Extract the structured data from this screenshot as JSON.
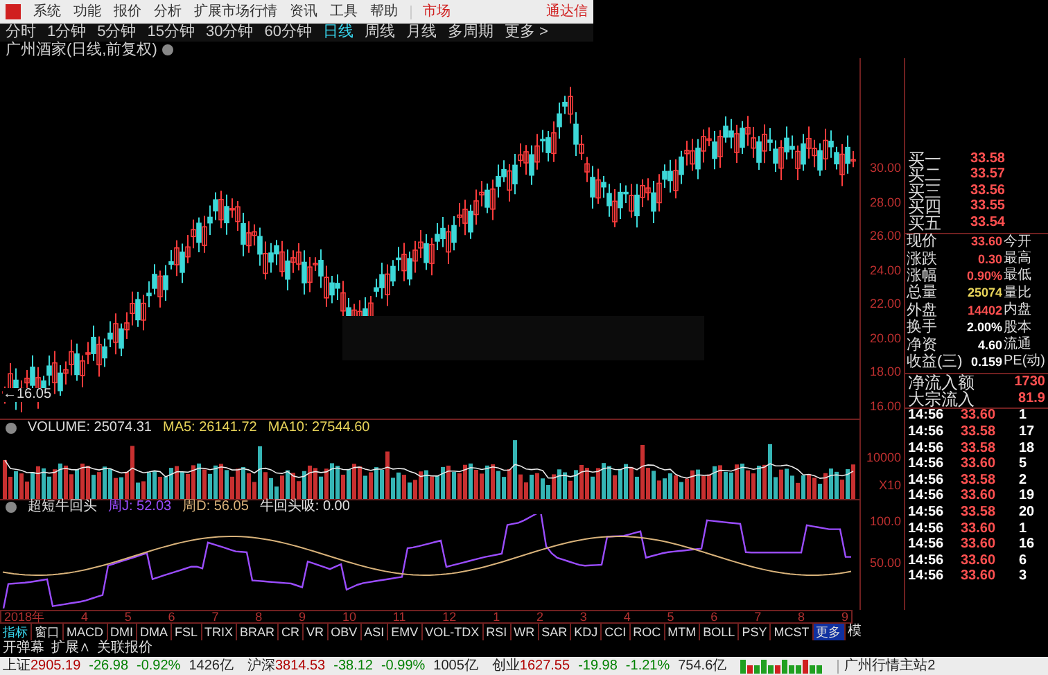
{
  "menu": {
    "items": [
      "系统",
      "功能",
      "报价",
      "分析",
      "扩展市场行情",
      "资讯",
      "工具",
      "帮助"
    ],
    "market": "市场",
    "brand": "通达信"
  },
  "periods": [
    {
      "label": "分时",
      "selected": false
    },
    {
      "label": "1分钟",
      "selected": false
    },
    {
      "label": "5分钟",
      "selected": false
    },
    {
      "label": "15分钟",
      "selected": false
    },
    {
      "label": "30分钟",
      "selected": false
    },
    {
      "label": "60分钟",
      "selected": false
    },
    {
      "label": "日线",
      "selected": true
    },
    {
      "label": "周线",
      "selected": false
    },
    {
      "label": "月线",
      "selected": false
    },
    {
      "label": "多周期",
      "selected": false
    },
    {
      "label": "更多 >",
      "selected": false
    }
  ],
  "chart_title": "广州酒家(日线,前复权)",
  "low_label": "←16.05",
  "price_axis": [
    "30.00",
    "28.00",
    "26.00",
    "24.00",
    "22.00",
    "20.00",
    "18.00",
    "16.00"
  ],
  "volume": {
    "label": "VOLUME: 25074.31",
    "ma5": "MA5: 26141.72",
    "ma10": "MA10: 27544.60",
    "axis": [
      "10000",
      "X10"
    ]
  },
  "indicator": {
    "name": "超短牛回头",
    "lines": [
      {
        "label": "周J: 52.03",
        "color": "#9b4dff"
      },
      {
        "label": "周D: 56.05",
        "color": "#d8b27a"
      },
      {
        "label": "牛回头吸: 0.00",
        "color": "#e0e0e0"
      }
    ],
    "axis": [
      "100.0",
      "50.00"
    ]
  },
  "date_axis": [
    "2018年",
    "4",
    "5",
    "6",
    "7",
    "8",
    "9",
    "10",
    "11",
    "12",
    "1",
    "2",
    "3",
    "4",
    "5",
    "6",
    "7",
    "8",
    "9"
  ],
  "indicator_tabs": [
    {
      "label": "指标",
      "selected": true,
      "kind": "tab"
    },
    {
      "label": "窗口",
      "selected": false,
      "kind": "tab"
    },
    {
      "label": "MACD",
      "selected": false,
      "kind": "tab"
    },
    {
      "label": "DMI",
      "selected": false,
      "kind": "tab"
    },
    {
      "label": "DMA",
      "selected": false,
      "kind": "tab"
    },
    {
      "label": "FSL",
      "selected": false,
      "kind": "tab"
    },
    {
      "label": "TRIX",
      "selected": false,
      "kind": "tab"
    },
    {
      "label": "BRAR",
      "selected": false,
      "kind": "tab"
    },
    {
      "label": "CR",
      "selected": false,
      "kind": "tab"
    },
    {
      "label": "VR",
      "selected": false,
      "kind": "tab"
    },
    {
      "label": "OBV",
      "selected": false,
      "kind": "tab"
    },
    {
      "label": "ASI",
      "selected": false,
      "kind": "tab"
    },
    {
      "label": "EMV",
      "selected": false,
      "kind": "tab"
    },
    {
      "label": "VOL-TDX",
      "selected": false,
      "kind": "tab"
    },
    {
      "label": "RSI",
      "selected": false,
      "kind": "tab"
    },
    {
      "label": "WR",
      "selected": false,
      "kind": "tab"
    },
    {
      "label": "SAR",
      "selected": false,
      "kind": "tab"
    },
    {
      "label": "KDJ",
      "selected": false,
      "kind": "tab"
    },
    {
      "label": "CCI",
      "selected": false,
      "kind": "tab"
    },
    {
      "label": "ROC",
      "selected": false,
      "kind": "tab"
    },
    {
      "label": "MTM",
      "selected": false,
      "kind": "tab"
    },
    {
      "label": "BOLL",
      "selected": false,
      "kind": "tab"
    },
    {
      "label": "PSY",
      "selected": false,
      "kind": "tab"
    },
    {
      "label": "MCST",
      "selected": false,
      "kind": "tab"
    },
    {
      "label": "更多",
      "selected": false,
      "kind": "more"
    }
  ],
  "edge_button": "模",
  "bottom_tools": [
    "开弹幕",
    "扩展∧",
    "关联报价"
  ],
  "quote": {
    "bids": [
      {
        "label": "买一",
        "price": "33.58"
      },
      {
        "label": "买二",
        "price": "33.57"
      },
      {
        "label": "买三",
        "price": "33.56"
      },
      {
        "label": "买四",
        "price": "33.55"
      },
      {
        "label": "买五",
        "price": "33.54"
      }
    ],
    "stats": [
      {
        "label": "现价",
        "value": "33.60",
        "color": "#ff5050",
        "label2": "今开"
      },
      {
        "label": "涨跌",
        "value": "0.30",
        "color": "#ff5050",
        "label2": "最高"
      },
      {
        "label": "涨幅",
        "value": "0.90%",
        "color": "#ff5050",
        "label2": "最低"
      },
      {
        "label": "总量",
        "value": "25074",
        "color": "#e8d45a",
        "label2": "量比"
      },
      {
        "label": "外盘",
        "value": "14402",
        "color": "#ff5050",
        "label2": "内盘"
      },
      {
        "label": "换手",
        "value": "2.00%",
        "color": "#ffffff",
        "label2": "股本"
      },
      {
        "label": "净资",
        "value": "4.60",
        "color": "#ffffff",
        "label2": "流通"
      },
      {
        "label": "收益(三)",
        "value": "0.159",
        "color": "#ffffff",
        "label2": "PE(动)"
      }
    ],
    "flows": [
      {
        "label": "净流入额",
        "value": "1730"
      },
      {
        "label": "大宗流入",
        "value": "81.9"
      }
    ],
    "trades": [
      {
        "time": "14:56",
        "price": "33.60",
        "volume": "1"
      },
      {
        "time": "14:56",
        "price": "33.58",
        "volume": "17"
      },
      {
        "time": "14:56",
        "price": "33.58",
        "volume": "18"
      },
      {
        "time": "14:56",
        "price": "33.60",
        "volume": "5"
      },
      {
        "time": "14:56",
        "price": "33.58",
        "volume": "2"
      },
      {
        "time": "14:56",
        "price": "33.60",
        "volume": "19"
      },
      {
        "time": "14:56",
        "price": "33.58",
        "volume": "20"
      },
      {
        "time": "14:56",
        "price": "33.60",
        "volume": "1"
      },
      {
        "time": "14:56",
        "price": "33.60",
        "volume": "16"
      },
      {
        "time": "14:56",
        "price": "33.60",
        "volume": "6"
      },
      {
        "time": "14:56",
        "price": "33.60",
        "volume": "3"
      }
    ]
  },
  "status_bar": {
    "indices": [
      {
        "name": "上证",
        "value": "2905.19",
        "change": "-26.98",
        "percent": "-0.92%",
        "amount": "1426亿"
      },
      {
        "name": "沪深",
        "value": "3814.53",
        "change": "-38.12",
        "percent": "-0.99%",
        "amount": "1005亿"
      },
      {
        "name": "创业",
        "value": "1627.55",
        "change": "-19.98",
        "percent": "-1.21%",
        "amount": "754.6亿"
      }
    ],
    "server": "广州行情主站2"
  }
}
